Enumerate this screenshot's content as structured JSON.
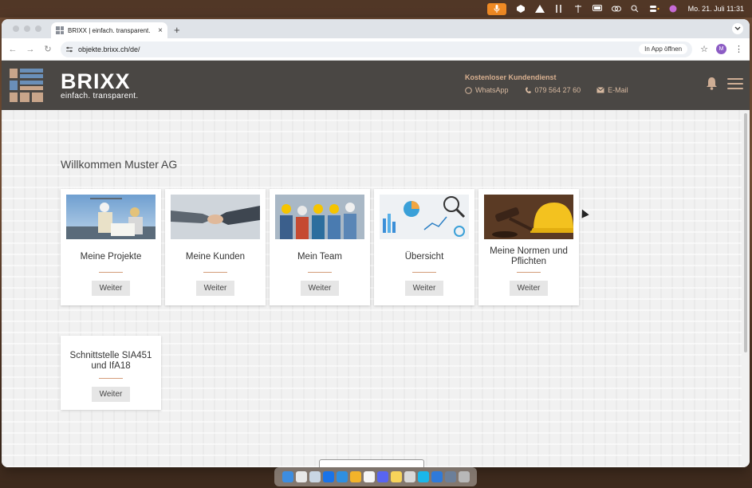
{
  "menubar": {
    "date_time": "Mo. 21. Juli  11:31"
  },
  "browser": {
    "tab_title": "BRIXX | einfach. transparent.",
    "tab_close": "×",
    "new_tab": "+",
    "url": "objekte.brixx.ch/de/",
    "open_in_app": "In App öffnen",
    "profile_initial": "M"
  },
  "header": {
    "brand_name": "BRIXX",
    "brand_tagline": "einfach. transparent.",
    "service_title": "Kostenloser Kundendienst",
    "whatsapp": "WhatsApp",
    "phone": "079 564 27 60",
    "email": "E-Mail"
  },
  "main": {
    "welcome": "Willkommen Muster AG",
    "cards": [
      {
        "title": "Meine Projekte",
        "button": "Weiter",
        "image": "construction-workers-photo"
      },
      {
        "title": "Meine Kunden",
        "button": "Weiter",
        "image": "handshake-photo"
      },
      {
        "title": "Mein Team",
        "button": "Weiter",
        "image": "team-workers-photo"
      },
      {
        "title": "Übersicht",
        "button": "Weiter",
        "image": "charts-magnifier-photo"
      },
      {
        "title": "Meine Normen und Pflichten",
        "button": "Weiter",
        "image": "gavel-helmet-photo"
      },
      {
        "title": "Schnittstelle SIA451 und IfA18",
        "button": "Weiter"
      }
    ]
  },
  "colors": {
    "header_bg": "#4a4744",
    "accent": "#d9b090",
    "logo_blue": "#6a8fb8",
    "logo_tan": "#c8a58a"
  }
}
